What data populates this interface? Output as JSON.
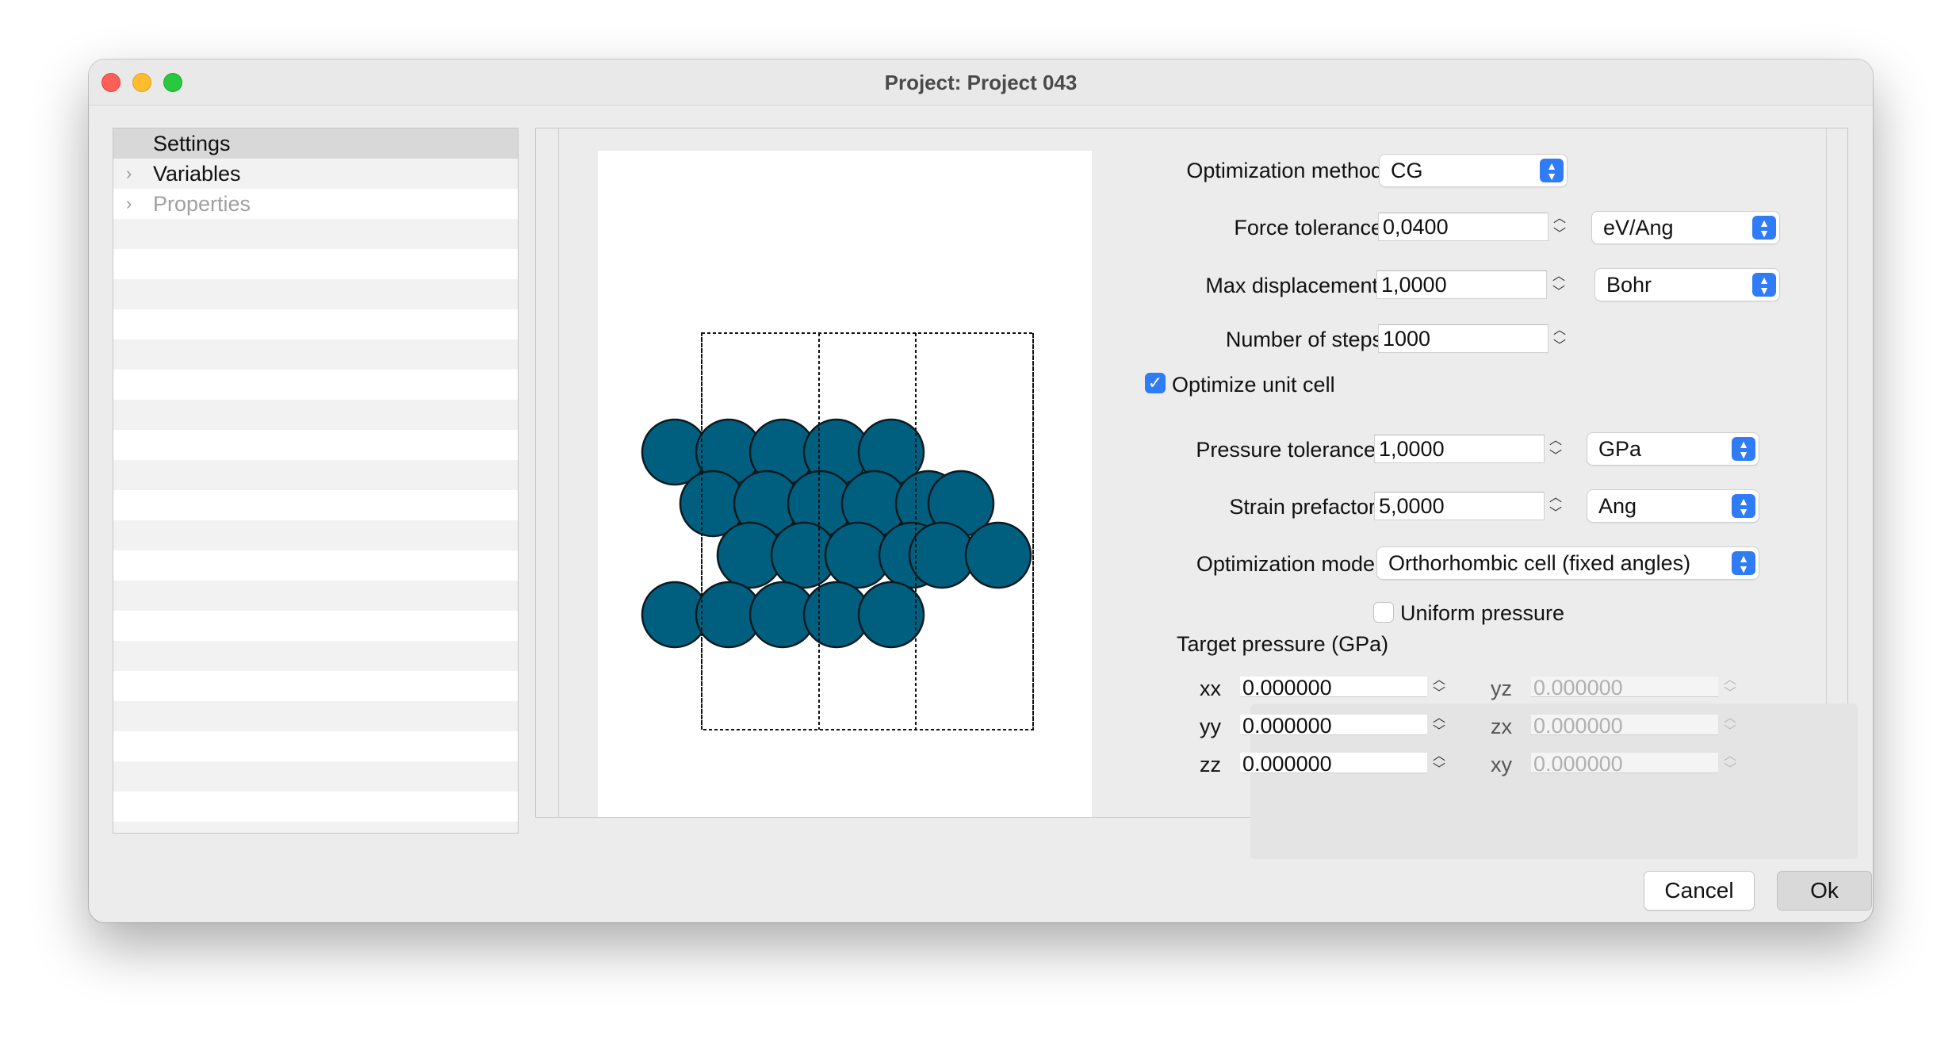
{
  "window": {
    "title": "Project: Project 043"
  },
  "sidebar": {
    "items": [
      {
        "label": "Settings"
      },
      {
        "label": "Variables"
      },
      {
        "label": "Properties"
      }
    ]
  },
  "form": {
    "optimization_method": {
      "label": "Optimization method",
      "value": "CG"
    },
    "force_tolerance": {
      "label": "Force tolerance",
      "value": "0,0400",
      "unit": "eV/Ang"
    },
    "max_displacement": {
      "label": "Max displacement",
      "value": "1,0000",
      "unit": "Bohr"
    },
    "number_of_steps": {
      "label": "Number of  steps",
      "value": "1000"
    },
    "optimize_unit_cell": {
      "label": "Optimize unit cell",
      "checked": true
    },
    "pressure_tolerance": {
      "label": "Pressure tolerance",
      "value": "1,0000",
      "unit": "GPa"
    },
    "strain_prefactor": {
      "label": "Strain prefactor",
      "value": "5,0000",
      "unit": "Ang"
    },
    "optimization_mode": {
      "label": "Optimization mode",
      "value": "Orthorhombic cell (fixed angles)"
    },
    "uniform_pressure": {
      "label": "Uniform pressure",
      "checked": false
    },
    "target_pressure": {
      "title": "Target pressure (GPa)",
      "xx": {
        "label": "xx",
        "value": "0.000000"
      },
      "yy": {
        "label": "yy",
        "value": "0.000000"
      },
      "zz": {
        "label": "zz",
        "value": "0.000000"
      },
      "yz": {
        "label": "yz",
        "value": "0.000000"
      },
      "zx": {
        "label": "zx",
        "value": "0.000000"
      },
      "xy": {
        "label": "xy",
        "value": "0.000000"
      }
    }
  },
  "buttons": {
    "cancel": "Cancel",
    "ok": "Ok"
  },
  "colors": {
    "atom_fill": "#005f7f",
    "accent": "#2f7cf6"
  }
}
